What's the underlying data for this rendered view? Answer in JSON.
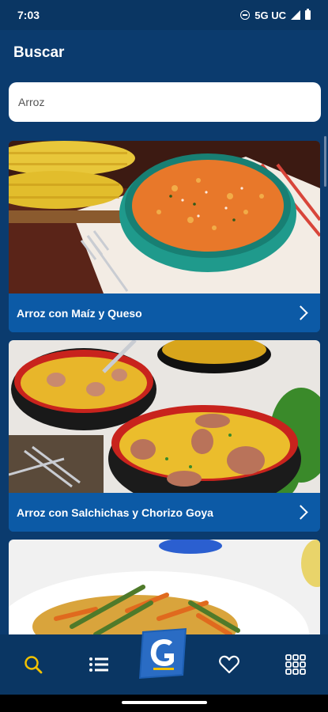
{
  "status_bar": {
    "time": "7:03",
    "network": "5G UC"
  },
  "header": {
    "title": "Buscar"
  },
  "search": {
    "value": "Arroz"
  },
  "recipes": [
    {
      "title": "Arroz con Maíz y Queso"
    },
    {
      "title": "Arroz con Salchichas y Chorizo Goya"
    }
  ],
  "nav": {
    "items": [
      "search-icon",
      "list-icon",
      "goya-logo",
      "heart-icon",
      "grid-icon"
    ],
    "active_color": "#f2c200",
    "icon_color": "#ffffff"
  },
  "colors": {
    "background": "#0b3b6e",
    "card_label": "#0c5aa6"
  }
}
